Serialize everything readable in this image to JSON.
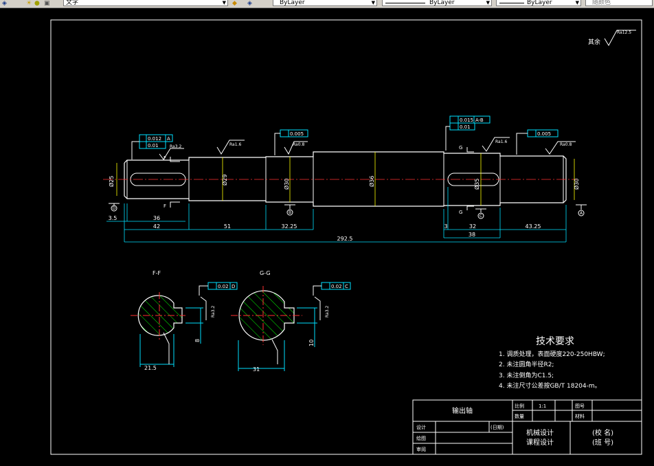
{
  "toolbar": {
    "text_style_value": "文字",
    "layer_linetype_value": "ByLayer",
    "lineweight_value": "ByLayer",
    "linetype_value": "ByLayer",
    "color_value": "随颜色"
  },
  "drawing": {
    "roughness_default_prefix": "其余",
    "roughness_default": "Ra12.5",
    "section_f_title": "F-F",
    "section_g_title": "G-G",
    "fcf_runout_left": "0.012",
    "fcf_runout_left_ref": "A",
    "fcf_cyl_left": "0.01",
    "fcf_runout_mid": "0.005",
    "fcf_runout_right": "0.015",
    "fcf_runout_right_ref": "A-B",
    "fcf_cyl_right": "0.01",
    "fcf_runout_end": "0.005",
    "fcf_sym_f": "0.02",
    "fcf_sym_f_ref": "D",
    "fcf_sym_g": "0.02",
    "fcf_sym_g_ref": "C",
    "ra_16": "Ra1.6",
    "ra_08": "Ra0.8",
    "ra_32": "Ra3.2",
    "dim_35": "3.5",
    "dim_36": "36",
    "dim_42": "42",
    "dim_51": "51",
    "dim_3225": "32.25",
    "dim_3": "3",
    "dim_32": "32",
    "dim_38": "38",
    "dim_4325": "43.25",
    "dim_total": "292.5",
    "dia_25": "Ø25",
    "dia_29": "Ø29",
    "dia_30": "Ø30",
    "dia_36": "Ø36",
    "dia_35": "Ø35",
    "sec_f_width": "21.5",
    "sec_f_key": "8",
    "sec_g_width": "31",
    "sec_g_key": "10",
    "datum_a": "A",
    "datum_b": "B",
    "datum_c": "C",
    "datum_d": "D",
    "cut_f": "F",
    "cut_g": "G"
  },
  "tech_requirements": {
    "title": "技术要求",
    "items": [
      "1. 调质处理，表面硬度220-250HBW;",
      "2. 未注圆角半径R2;",
      "3. 未注倒角为C1.5;",
      "4. 未注尺寸公差按GB/T 18204-m。"
    ]
  },
  "title_block": {
    "part_name": "输出轴",
    "scale_label": "比例",
    "scale_value": "1:1",
    "drawing_no_label": "图号",
    "quantity_label": "数量",
    "material_label": "材料",
    "design_label": "设计",
    "date_label": "(日期)",
    "drawn_label": "绘图",
    "checked_label": "审阅",
    "course_line1": "机械设计",
    "course_line2": "课程设计",
    "school_label": "(校 名)",
    "class_label": "(班 号)"
  }
}
